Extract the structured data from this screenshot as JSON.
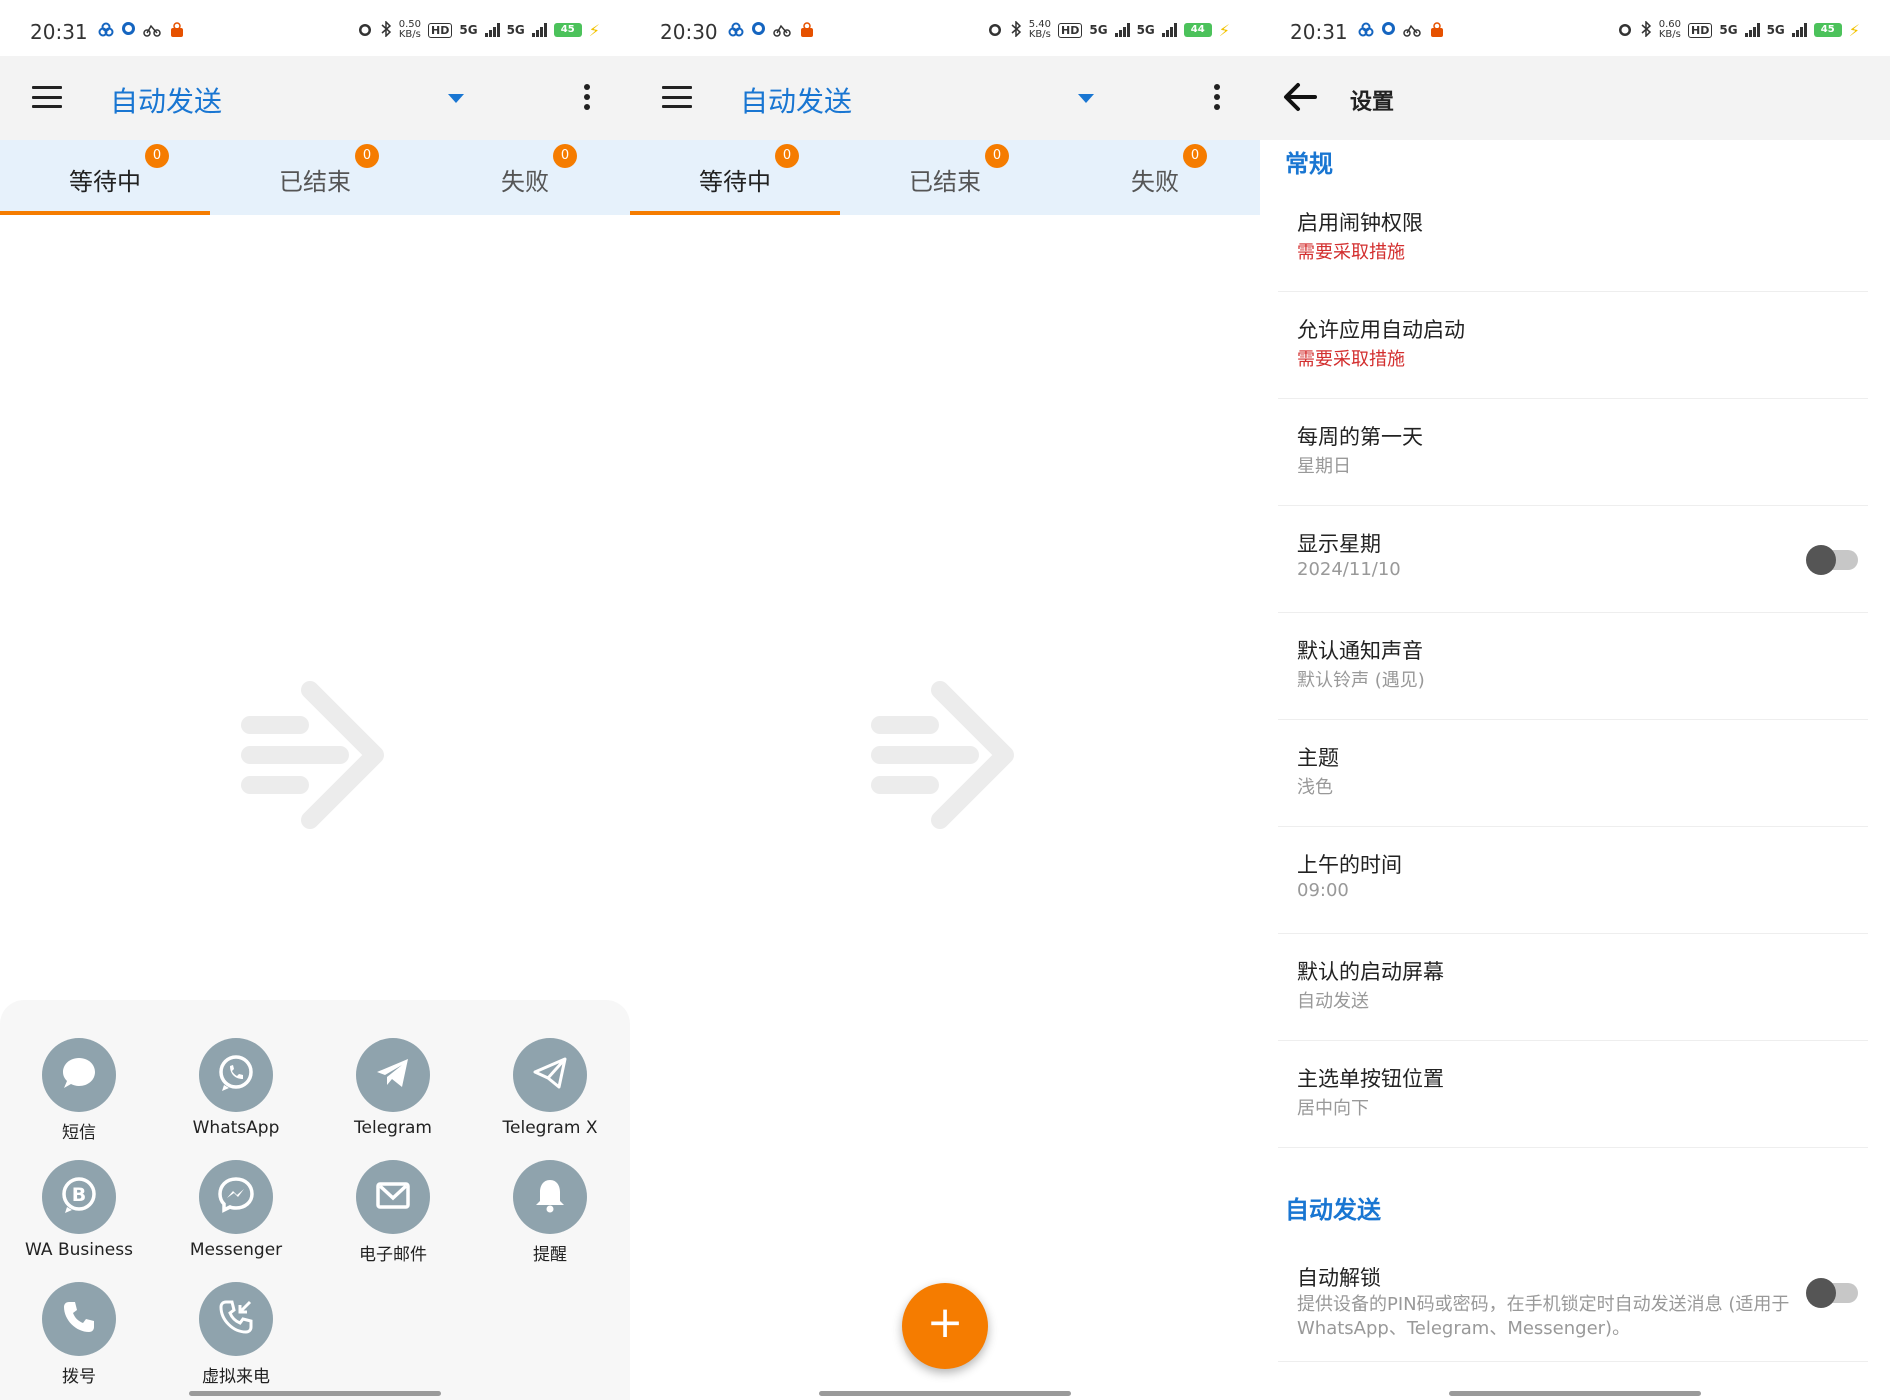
{
  "status_bars": [
    {
      "time": "20:31",
      "speed_top": "0.50",
      "speed_bottom": "KB/s",
      "battery": "45"
    },
    {
      "time": "20:30",
      "speed_top": "5.40",
      "speed_bottom": "KB/s",
      "battery": "44"
    },
    {
      "time": "20:31",
      "speed_top": "0.60",
      "speed_bottom": "KB/s",
      "battery": "45"
    }
  ],
  "status_labels": {
    "hd": "HD",
    "net1": "5G",
    "net2": "5G"
  },
  "app": {
    "title": "自动发送"
  },
  "tabs": [
    {
      "label": "等待中",
      "count": "0"
    },
    {
      "label": "已结束",
      "count": "0"
    },
    {
      "label": "失败",
      "count": "0"
    }
  ],
  "sheet_items": [
    {
      "label": "短信",
      "icon": "chat-bubble-icon"
    },
    {
      "label": "WhatsApp",
      "icon": "whatsapp-icon"
    },
    {
      "label": "Telegram",
      "icon": "telegram-icon"
    },
    {
      "label": "Telegram X",
      "icon": "telegram-x-icon"
    },
    {
      "label": "WA Business",
      "icon": "wa-business-icon"
    },
    {
      "label": "Messenger",
      "icon": "messenger-icon"
    },
    {
      "label": "电子邮件",
      "icon": "email-icon"
    },
    {
      "label": "提醒",
      "icon": "bell-icon"
    },
    {
      "label": "拨号",
      "icon": "phone-icon"
    },
    {
      "label": "虚拟来电",
      "icon": "incoming-call-icon"
    }
  ],
  "fab": {
    "label": "+"
  },
  "settings": {
    "title": "设置",
    "section_general": "常规",
    "section_auto": "自动发送",
    "rows": [
      {
        "title": "启用闹钟权限",
        "subtitle": "需要采取措施"
      },
      {
        "title": "允许应用自动启动",
        "subtitle": "需要采取措施"
      },
      {
        "title": "每周的第一天",
        "subtitle": "星期日"
      },
      {
        "title": "显示星期",
        "subtitle": "2024/11/10"
      },
      {
        "title": "默认通知声音",
        "subtitle": "默认铃声 (遇见)"
      },
      {
        "title": "主题",
        "subtitle": "浅色"
      },
      {
        "title": "上午的时间",
        "subtitle": "09:00"
      },
      {
        "title": "默认的启动屏幕",
        "subtitle": "自动发送"
      },
      {
        "title": "主选单按钮位置",
        "subtitle": "居中向下"
      }
    ],
    "auto_unlock": {
      "title": "自动解锁",
      "subtitle": "提供设备的PIN码或密码，在手机锁定时自动发送消息 (适用于WhatsApp、Telegram、Messenger)。"
    }
  },
  "colors": {
    "accent": "#1976d2",
    "orange": "#f57c00",
    "tab_bg": "#e6f1fb",
    "warn": "#d32f2f",
    "icon_gray": "#8fa3ad"
  }
}
